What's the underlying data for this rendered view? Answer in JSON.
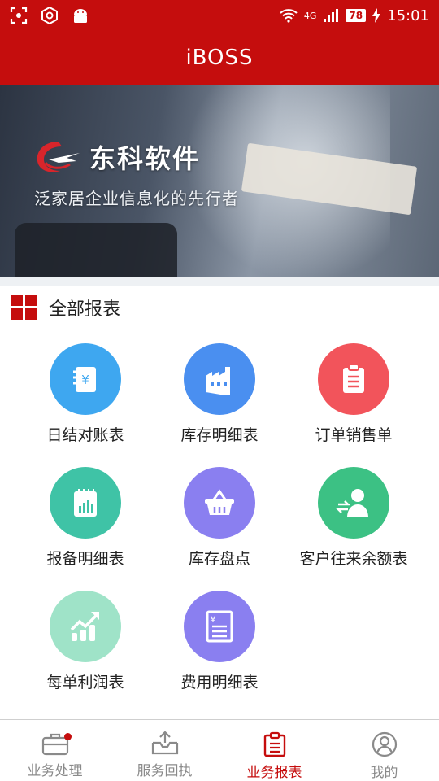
{
  "status_bar": {
    "time": "15:01",
    "battery": "78",
    "network": "4G"
  },
  "app_title": "iBOSS",
  "banner": {
    "brand_name": "东科软件",
    "slogan": "泛家居企业信息化的先行者"
  },
  "section": {
    "title": "全部报表"
  },
  "reports": [
    {
      "label": "日结对账表",
      "icon": "ledger-icon",
      "color": "#3ea7f0"
    },
    {
      "label": "库存明细表",
      "icon": "warehouse-icon",
      "color": "#4a8ff0"
    },
    {
      "label": "订单销售单",
      "icon": "clipboard-icon",
      "color": "#f2545b"
    },
    {
      "label": "报备明细表",
      "icon": "report-chart-icon",
      "color": "#3fc3a6"
    },
    {
      "label": "库存盘点",
      "icon": "basket-icon",
      "color": "#8a7ff0"
    },
    {
      "label": "客户往来余额表",
      "icon": "customer-exchange-icon",
      "color": "#3cc184"
    },
    {
      "label": "每单利润表",
      "icon": "profit-chart-icon",
      "color": "#9fe3c8"
    },
    {
      "label": "费用明细表",
      "icon": "expense-doc-icon",
      "color": "#8a7ff0"
    }
  ],
  "tabs": [
    {
      "label": "业务处理",
      "icon": "briefcase-icon",
      "active": false,
      "badge": true
    },
    {
      "label": "服务回执",
      "icon": "inbox-upload-icon",
      "active": false,
      "badge": false
    },
    {
      "label": "业务报表",
      "icon": "clipboard-list-icon",
      "active": true,
      "badge": false
    },
    {
      "label": "我的",
      "icon": "user-icon",
      "active": false,
      "badge": false
    }
  ],
  "colors": {
    "brand_red": "#c50d0d",
    "tab_inactive": "#8a8a8a"
  }
}
